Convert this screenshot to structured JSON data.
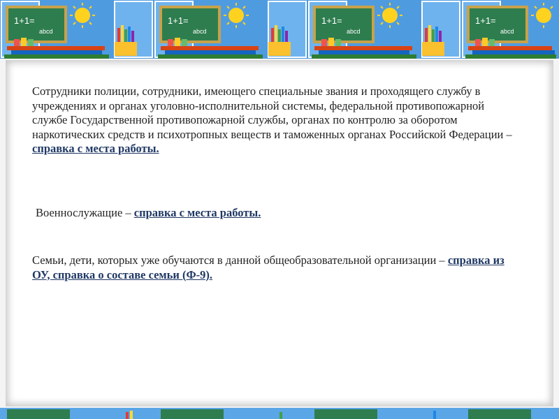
{
  "slide": {
    "paragraphs": [
      {
        "text": "Сотрудники полиции, сотрудники, имеющего специальные звания и проходящего службу в учреждениях и органах уголовно-исполнительной системы, федеральной противопожарной службе Государственной противопожарной службы, органах по контролю за оборотом наркотических средств и психотропных веществ и таможенных органах Российской Федерации – ",
        "link": "справка с места работы."
      },
      {
        "text": "Военнослужащие – ",
        "link": "справка с места работы."
      },
      {
        "text": "Семьи, дети, которых  уже обучаются в данной общеобразовательной организации – ",
        "link": "справка из ОУ, справка о составе семьи (Ф-9)."
      }
    ],
    "banner": {
      "icons": [
        "chalkboard-icon",
        "sun-icon",
        "pencil-cup-icon",
        "books-icon"
      ],
      "chalkboard_text": "1+1=",
      "chalkboard_text2": "abcd",
      "colors": {
        "sky": "#4f9be0",
        "chalkboard": "#2e7d4f",
        "board_frame": "#c8a24a",
        "sun": "#ffd21f",
        "link": "#1f3864"
      }
    }
  }
}
